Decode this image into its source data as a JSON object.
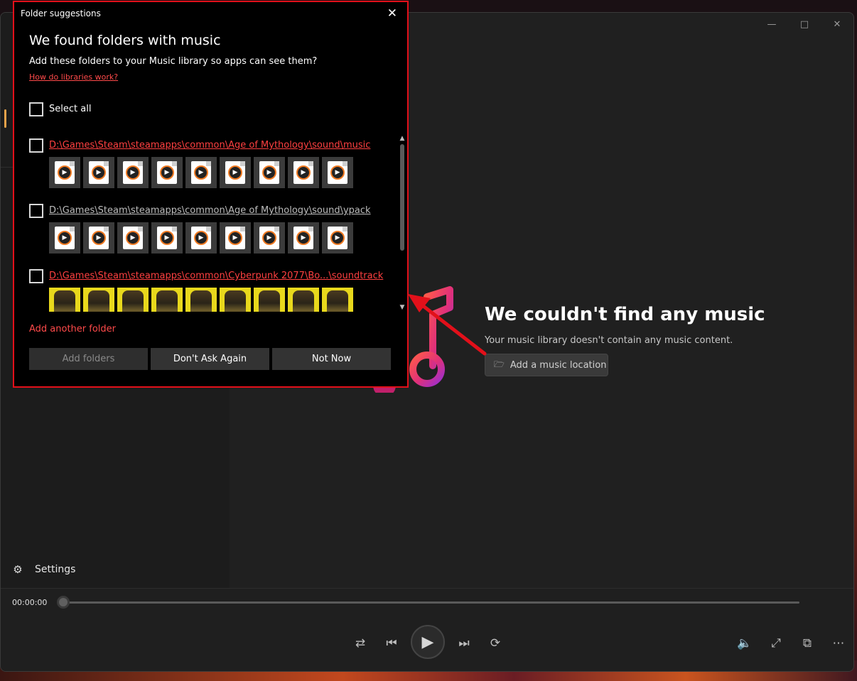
{
  "window": {
    "minimize_icon": "minimize-icon",
    "maximize_icon": "maximize-icon",
    "close_icon": "close-icon"
  },
  "sidebar": {
    "settings_label": "Settings"
  },
  "empty_state": {
    "title": "We couldn't find any music",
    "subtitle": "Your music library doesn't contain any music content.",
    "add_location_label": "Add a music location"
  },
  "player": {
    "time": "00:00:00"
  },
  "dialog": {
    "title": "Folder suggestions",
    "heading": "We found folders with music",
    "subtitle": "Add these folders to your Music library so apps can see them?",
    "link": "How do libraries work?",
    "select_all": "Select all",
    "folders": [
      {
        "path": "D:\\Games\\Steam\\steamapps\\common\\Age of Mythology\\sound\\music",
        "color": "#ff4040"
      },
      {
        "path": "D:\\Games\\Steam\\steamapps\\common\\Age of Mythology\\sound\\ypack",
        "color": "#bdbdbd"
      },
      {
        "path": "D:\\Games\\Steam\\steamapps\\common\\Cyberpunk 2077\\Bo...\\soundtrack",
        "color": "#ff4040"
      }
    ],
    "add_another": "Add another folder",
    "buttons": {
      "add_folders": "Add folders",
      "dont_ask": "Don't Ask Again",
      "not_now": "Not Now"
    }
  },
  "colors": {
    "accent_red": "#e2101a",
    "link_red": "#ff4a4a",
    "sidebar_selection": "#e8a24a"
  }
}
